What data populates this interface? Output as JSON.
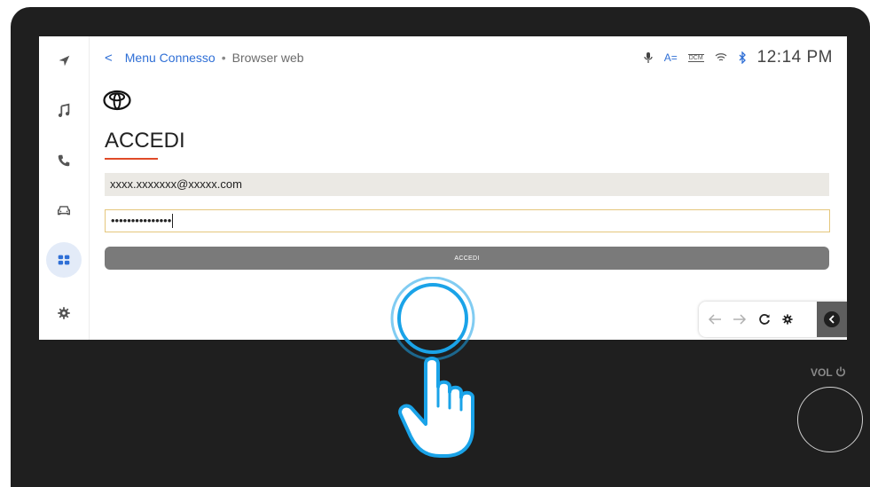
{
  "header": {
    "breadcrumb_parent": "Menu Connesso",
    "breadcrumb_separator": "•",
    "breadcrumb_current": "Browser web",
    "back_glyph": "<",
    "status_icons": [
      "mic-icon",
      "text-size-icon",
      "dcm-icon",
      "wifi-icon",
      "bluetooth-icon"
    ],
    "status_dcm_text": "DCM",
    "status_text_size_text": "A=",
    "clock": "12:14 PM"
  },
  "sidebar": {
    "items": [
      {
        "icon": "navigation-icon",
        "active": false
      },
      {
        "icon": "music-icon",
        "active": false
      },
      {
        "icon": "phone-icon",
        "active": false
      },
      {
        "icon": "car-icon",
        "active": false
      },
      {
        "icon": "apps-icon",
        "active": true
      },
      {
        "icon": "settings-icon",
        "active": false
      }
    ]
  },
  "login": {
    "logo": "toyota-logo",
    "title": "ACCEDI",
    "email_value": "xxxx.xxxxxxx@xxxxx.com",
    "password_value": "•••••••••••••••",
    "submit_label": "ACCEDI"
  },
  "browser_controls": {
    "icons": [
      "back-arrow-icon",
      "forward-arrow-icon",
      "reload-icon",
      "settings-icon",
      "collapse-icon"
    ]
  },
  "hardware": {
    "vol_label": "VOL"
  },
  "colors": {
    "accent": "#2f6fd6",
    "title_underline": "#e04a28",
    "tap_highlight": "#1aa3e8",
    "bezel": "#1f1f1f"
  }
}
